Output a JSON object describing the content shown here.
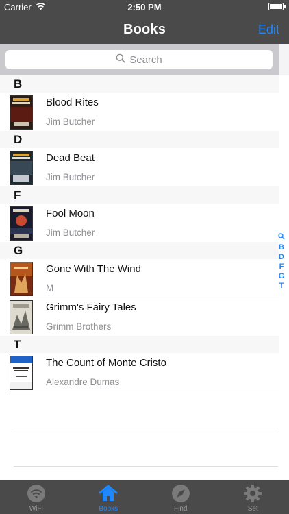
{
  "status_bar": {
    "carrier": "Carrier",
    "time": "2:50 PM"
  },
  "nav": {
    "title": "Books",
    "edit_label": "Edit"
  },
  "search": {
    "placeholder": "Search"
  },
  "section_index": [
    "B",
    "D",
    "F",
    "G",
    "T"
  ],
  "sections": [
    {
      "letter": "B",
      "rows": [
        {
          "title": "Blood Rites",
          "author": "Jim Butcher"
        }
      ]
    },
    {
      "letter": "D",
      "rows": [
        {
          "title": "Dead Beat",
          "author": "Jim Butcher"
        }
      ]
    },
    {
      "letter": "F",
      "rows": [
        {
          "title": "Fool Moon",
          "author": "Jim Butcher"
        }
      ]
    },
    {
      "letter": "G",
      "rows": [
        {
          "title": "Gone With The Wind",
          "author": "M"
        },
        {
          "title": "Grimm's Fairy Tales",
          "author": "Grimm Brothers"
        }
      ]
    },
    {
      "letter": "T",
      "rows": [
        {
          "title": "The Count of Monte Cristo",
          "author": "Alexandre Dumas"
        }
      ]
    }
  ],
  "tabs": [
    {
      "label": "WiFi",
      "icon": "wifi-icon",
      "active": false
    },
    {
      "label": "Books",
      "icon": "home-icon",
      "active": true
    },
    {
      "label": "Find",
      "icon": "compass-icon",
      "active": false
    },
    {
      "label": "Set",
      "icon": "gear-icon",
      "active": false
    }
  ],
  "colors": {
    "accent": "#1e88ff",
    "bar_bg": "#4a4a4a"
  }
}
